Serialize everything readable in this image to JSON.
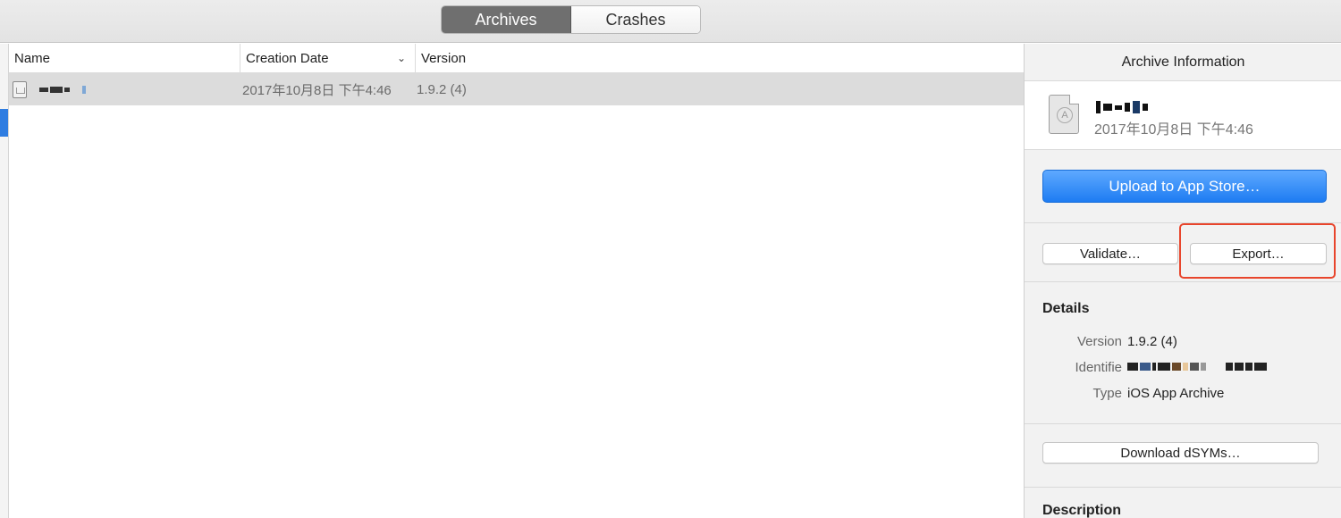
{
  "toolbar": {
    "tabs": [
      {
        "label": "Archives",
        "active": true
      },
      {
        "label": "Crashes",
        "active": false
      }
    ]
  },
  "table": {
    "columns": [
      "Name",
      "Creation Date",
      "Version"
    ],
    "sort_column": "Creation Date",
    "rows": [
      {
        "name": "",
        "creation_date": "2017年10月8日 下午4:46",
        "version": "1.9.2 (4)",
        "selected": true
      }
    ]
  },
  "panel": {
    "header": "Archive Information",
    "archive_name": "",
    "archive_date": "2017年10月8日 下午4:46",
    "upload_button": "Upload to App Store…",
    "validate_button": "Validate…",
    "export_button": "Export…",
    "details_title": "Details",
    "details": {
      "version_label": "Version",
      "version_value": "1.9.2 (4)",
      "identifier_label": "Identifie",
      "identifier_value": "",
      "type_label": "Type",
      "type_value": "iOS App Archive"
    },
    "download_dsyms_button": "Download dSYMs…",
    "description_title": "Description"
  },
  "colors": {
    "accent": "#1e7cf2",
    "selection": "#2f7de1",
    "highlight_box": "#e8452c"
  },
  "icons": [
    "archive-document-icon",
    "sort-chevron-down-icon"
  ]
}
